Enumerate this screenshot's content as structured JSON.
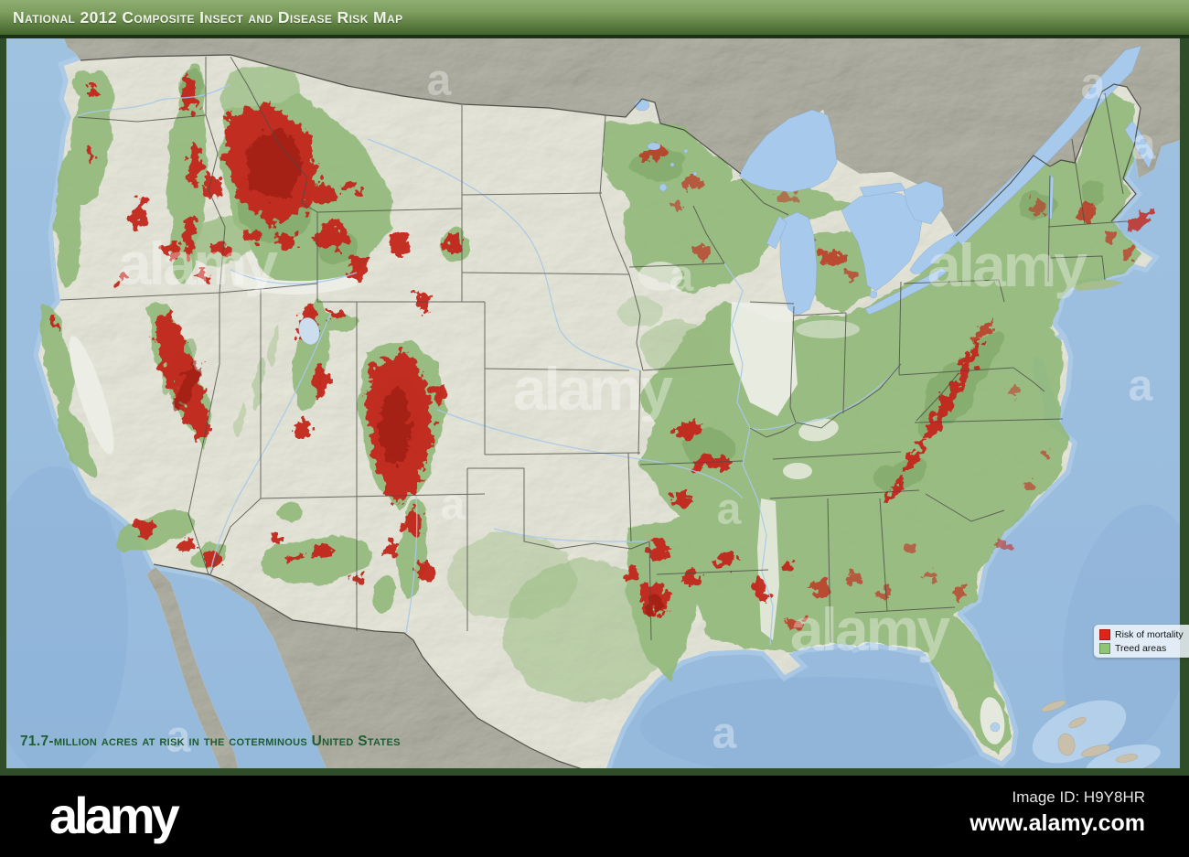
{
  "header": {
    "title": "National 2012 Composite Insect and Disease Risk Map"
  },
  "map": {
    "caption": "71.7-million acres at risk in the coterminous United States",
    "legend": {
      "items": [
        {
          "label": "Risk of mortality",
          "color": "#df251a",
          "swatch_style": "background:#df251a"
        },
        {
          "label": "Treed areas",
          "color": "#8fc578",
          "swatch_style": "background:#8fc578"
        }
      ]
    },
    "colors": {
      "ocean": "#9cc0e0",
      "lakes": "#a6c9ec",
      "neighbor_land": "#bcbcb5",
      "us_land": "#ecede5",
      "treed": "#93b97b",
      "risk": "#c3261a",
      "frame": "#2e4d28",
      "header_top": "#8fae72",
      "header_bottom": "#44642f",
      "caption_text": "#1f5c33"
    }
  },
  "watermark": {
    "brand": "alamy",
    "letter": "a"
  },
  "footer": {
    "logo": "alamy",
    "image_id": "Image ID: H9Y8HR",
    "url": "www.alamy.com"
  }
}
